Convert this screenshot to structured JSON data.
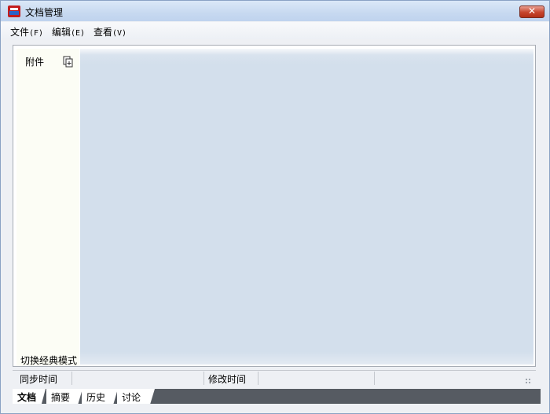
{
  "window": {
    "title": "文档管理",
    "close_symbol": "✕"
  },
  "menu": [
    {
      "label": "文件",
      "accel": "(F)"
    },
    {
      "label": "编辑",
      "accel": "(E)"
    },
    {
      "label": "查看",
      "accel": "(V)"
    }
  ],
  "sidebar": {
    "title": "附件",
    "add_icon": "add-attachment-icon",
    "switch_mode": "切换经典模式"
  },
  "status": {
    "sync_time_label": "同步时间",
    "modified_time_label": "修改时间"
  },
  "tabs": [
    {
      "label": "文档",
      "active": true
    },
    {
      "label": "摘要",
      "active": false
    },
    {
      "label": "历史",
      "active": false
    },
    {
      "label": "讨论",
      "active": false
    }
  ],
  "colors": {
    "content_bg": "#d3dfec",
    "sidebar_bg": "#fcfdf5",
    "tabbar_bg": "#565b62",
    "close_red": "#c7452d"
  }
}
